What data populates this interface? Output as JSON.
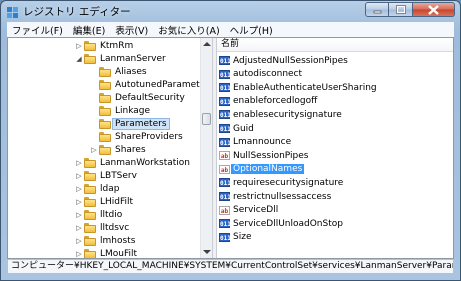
{
  "window": {
    "title": "レジストリ エディター"
  },
  "menu": [
    "ファイル(F)",
    "編集(E)",
    "表示(V)",
    "お気に入り(A)",
    "ヘルプ(H)"
  ],
  "tree": {
    "items": [
      {
        "label": "KtmRm",
        "level": 0,
        "expander": "▷"
      },
      {
        "label": "LanmanServer",
        "level": 0,
        "expander": "◢"
      },
      {
        "label": "Aliases",
        "level": 1,
        "expander": ""
      },
      {
        "label": "AutotunedParameters",
        "level": 1,
        "expander": ""
      },
      {
        "label": "DefaultSecurity",
        "level": 1,
        "expander": ""
      },
      {
        "label": "Linkage",
        "level": 1,
        "expander": ""
      },
      {
        "label": "Parameters",
        "level": 1,
        "expander": "",
        "selected": true
      },
      {
        "label": "ShareProviders",
        "level": 1,
        "expander": ""
      },
      {
        "label": "Shares",
        "level": 1,
        "expander": "▷"
      },
      {
        "label": "LanmanWorkstation",
        "level": 0,
        "expander": "▷"
      },
      {
        "label": "LBTServ",
        "level": 0,
        "expander": "▷"
      },
      {
        "label": "ldap",
        "level": 0,
        "expander": "▷"
      },
      {
        "label": "LHidFilt",
        "level": 0,
        "expander": "▷"
      },
      {
        "label": "lltdio",
        "level": 0,
        "expander": "▷"
      },
      {
        "label": "lltdsvc",
        "level": 0,
        "expander": "▷"
      },
      {
        "label": "lmhosts",
        "level": 0,
        "expander": "▷"
      },
      {
        "label": "LMouFilt",
        "level": 0,
        "expander": "▷"
      }
    ]
  },
  "values": {
    "column_header": "名前",
    "items": [
      {
        "name": "AdjustedNullSessionPipes",
        "type": "bin"
      },
      {
        "name": "autodisconnect",
        "type": "bin"
      },
      {
        "name": "EnableAuthenticateUserSharing",
        "type": "bin"
      },
      {
        "name": "enableforcedlogoff",
        "type": "bin"
      },
      {
        "name": "enablesecuritysignature",
        "type": "bin"
      },
      {
        "name": "Guid",
        "type": "bin"
      },
      {
        "name": "Lmannounce",
        "type": "bin"
      },
      {
        "name": "NullSessionPipes",
        "type": "str"
      },
      {
        "name": "OptionalNames",
        "type": "str",
        "selected": true
      },
      {
        "name": "requiresecuritysignature",
        "type": "bin"
      },
      {
        "name": "restrictnullsessaccess",
        "type": "bin"
      },
      {
        "name": "ServiceDll",
        "type": "str"
      },
      {
        "name": "ServiceDllUnloadOnStop",
        "type": "bin"
      },
      {
        "name": "Size",
        "type": "bin"
      }
    ]
  },
  "status": {
    "path": "コンピューター¥HKEY_LOCAL_MACHINE¥SYSTEM¥CurrentControlSet¥services¥LanmanServer¥Parameters"
  },
  "icons": {
    "app": "registry-icon",
    "folder": "folder-icon",
    "binary": "binary-value-icon",
    "string": "string-value-icon"
  }
}
